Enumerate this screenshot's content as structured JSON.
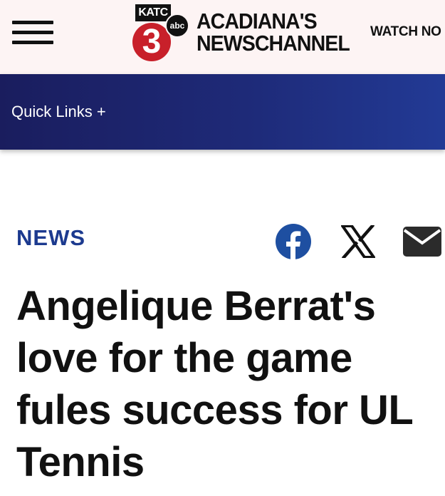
{
  "header": {
    "logo": {
      "badge_call_sign": "KATC",
      "badge_network": "abc",
      "badge_channel": "3",
      "title_line1": "ACADIANA'S",
      "title_line2": "NEWSCHANNEL"
    },
    "watch_now_label": "WATCH NO"
  },
  "nav": {
    "quick_links_label": "Quick Links +"
  },
  "article": {
    "section": "NEWS",
    "headline": "Angelique Berrat's love for the game fules success for UL Tennis"
  },
  "share": {
    "icons": [
      "facebook-icon",
      "x-icon",
      "email-icon"
    ]
  },
  "colors": {
    "topbar_bg": "#fdf4f4",
    "nav_gradient_start": "#1a1d5e",
    "nav_gradient_end": "#223a95",
    "section_label": "#1c3a8f",
    "facebook_blue": "#1e4fa1",
    "logo_red": "#c8202a"
  }
}
